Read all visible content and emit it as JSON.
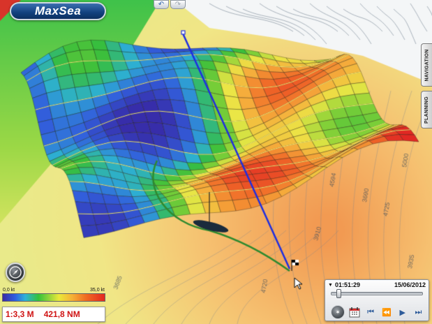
{
  "app": {
    "logo_text": "MaxSea"
  },
  "toolbar": {
    "undo_icon": "undo-icon",
    "redo_icon": "redo-icon"
  },
  "side_tabs": {
    "navigation": "NAVIGATION",
    "planning": "PLANNING"
  },
  "map": {
    "depth_labels": [
      "4594",
      "3910",
      "4720",
      "3685",
      "3690",
      "5000",
      "4725",
      "3935"
    ],
    "route_color": "#1f2ee0",
    "track_color": "#2f8a2f"
  },
  "legend": {
    "min_label": "0,0 kt",
    "max_label": "35,0 kt"
  },
  "status": {
    "scale": "1:3,3 M",
    "distance": "421,8 NM"
  },
  "timebar": {
    "time": "01:51:29",
    "date": "15/06/2012",
    "progress": 0.08,
    "controls": [
      "compass-icon",
      "calendar-icon",
      "first-icon",
      "step-back-icon",
      "play-icon",
      "last-icon"
    ]
  },
  "colors": {
    "accent": "#12407e",
    "status_text": "#d01414"
  }
}
